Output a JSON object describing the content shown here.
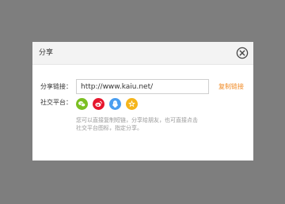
{
  "dialog": {
    "title": "分享",
    "close_icon": "close-circle-icon"
  },
  "share": {
    "link_label": "分享链接：",
    "url_value": "http://www.kaiu.net/",
    "copy_label": "复制链接",
    "social_label": "社交平台：",
    "platforms": [
      {
        "icon": "wechat-icon",
        "color": "#7bbf22"
      },
      {
        "icon": "weibo-icon",
        "color": "#e6162d"
      },
      {
        "icon": "qq-icon",
        "color": "#4a9ef0"
      },
      {
        "icon": "qzone-icon",
        "color": "#f5b51b"
      }
    ],
    "hint_line1": "您可以直接复制短链，分享给朋友，也可直接点击",
    "hint_line2": "社交平台图标，指定分享。"
  },
  "colors": {
    "overlay": "#7e7e7e",
    "accent": "#f08a24"
  }
}
